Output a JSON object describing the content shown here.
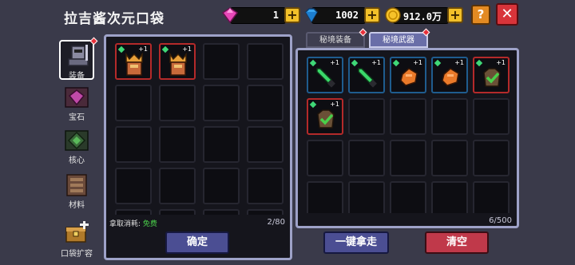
{
  "header": {
    "title": "拉吉酱次元口袋",
    "gem_value": "1",
    "diamond_value": "1002",
    "coin_value": "912.0万",
    "help_label": "?",
    "close_label": "✕"
  },
  "colors": {
    "accent_gold": "#f2c029",
    "close_red": "#d8343a",
    "panel_border": "#9ea2c8"
  },
  "sidebar": {
    "items": [
      {
        "label": "装备",
        "icon": "armor-icon"
      },
      {
        "label": "宝石",
        "icon": "gem-icon"
      },
      {
        "label": "核心",
        "icon": "core-icon"
      },
      {
        "label": "材料",
        "icon": "materials-icon"
      },
      {
        "label": "口袋扩容",
        "icon": "pocket-expand-icon"
      }
    ]
  },
  "left_panel": {
    "cost_label": "拿取消耗:",
    "cost_value": "免费",
    "count": "2/80",
    "confirm_label": "确定",
    "items": [
      {
        "icon": "crown-armor-icon",
        "level": "+1"
      },
      {
        "icon": "crown-armor-icon",
        "level": "+1"
      }
    ]
  },
  "right_panel": {
    "tabs": [
      {
        "label": "秘境装备"
      },
      {
        "label": "秘境武器"
      }
    ],
    "count": "6/500",
    "take_all_label": "一键拿走",
    "clear_label": "清空",
    "items": [
      {
        "icon": "green-sword-icon",
        "level": "+1"
      },
      {
        "icon": "green-sword-icon",
        "level": "+1"
      },
      {
        "icon": "orange-gauntlet-icon",
        "level": "+1"
      },
      {
        "icon": "orange-gauntlet-icon",
        "level": "+1"
      },
      {
        "icon": "check-pouch-icon",
        "level": "+1"
      },
      {
        "icon": "check-pouch-icon",
        "level": "+1"
      }
    ]
  }
}
